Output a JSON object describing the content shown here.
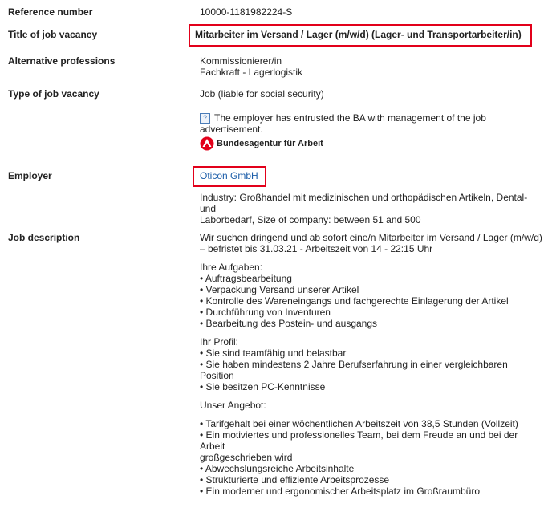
{
  "labels": {
    "reference": "Reference number",
    "title": "Title of job vacancy",
    "alternative": "Alternative professions",
    "type": "Type of job vacancy",
    "employer": "Employer",
    "description": "Job description"
  },
  "values": {
    "reference": "10000-1181982224-S",
    "title": "Mitarbeiter im Versand / Lager (m/w/d) (Lager- und Transportarbeiter/in)",
    "alternative": [
      "Kommissionierer/in",
      "Fachkraft - Lagerlogistik"
    ],
    "type": "Job (liable for social security)",
    "ba_notice": "The employer has entrusted the BA with management of the job advertisement.",
    "ba_name": "Bundesagentur für Arbeit",
    "employer_name": "Oticon GmbH",
    "industry": [
      "Industry: Großhandel mit medizinischen und orthopädischen Artikeln, Dental- und",
      "Laborbedarf, Size of company: between 51 and 500"
    ],
    "intro": [
      "Wir suchen dringend und ab sofort eine/n Mitarbeiter im Versand / Lager (m/w/d)",
      "– befristet bis 31.03.21 - Arbeitszeit von 14 - 22:15 Uhr"
    ],
    "tasks_title": "Ihre Aufgaben:",
    "tasks": [
      "• Auftragsbearbeitung",
      "• Verpackung Versand unserer Artikel",
      "• Kontrolle des Wareneingangs und fachgerechte Einlagerung der Artikel",
      "• Durchführung von Inventuren",
      "• Bearbeitung des Postein- und ausgangs"
    ],
    "profile_title": "Ihr Profil:",
    "profile": [
      "• Sie sind teamfähig und belastbar",
      "• Sie haben mindestens 2 Jahre Berufserfahrung in einer vergleichbaren Position",
      "• Sie besitzen PC-Kenntnisse"
    ],
    "offer_title": "Unser Angebot:",
    "offer": [
      "• Tarifgehalt bei einer wöchentlichen Arbeitszeit von 38,5 Stunden (Vollzeit)",
      "• Ein motiviertes und professionelles Team, bei dem Freude an und bei der Arbeit",
      "großgeschrieben wird",
      "• Abwechslungsreiche Arbeitsinhalte",
      "• Strukturierte und effiziente Arbeitsprozesse",
      "• Ein moderner und ergonomischer Arbeitsplatz im Großraumbüro"
    ]
  },
  "colors": {
    "highlight": "#e2001a",
    "ba_red": "#e2001a",
    "link": "#1a5ca8"
  },
  "icons": [
    "info-icon",
    "ba-logo"
  ]
}
